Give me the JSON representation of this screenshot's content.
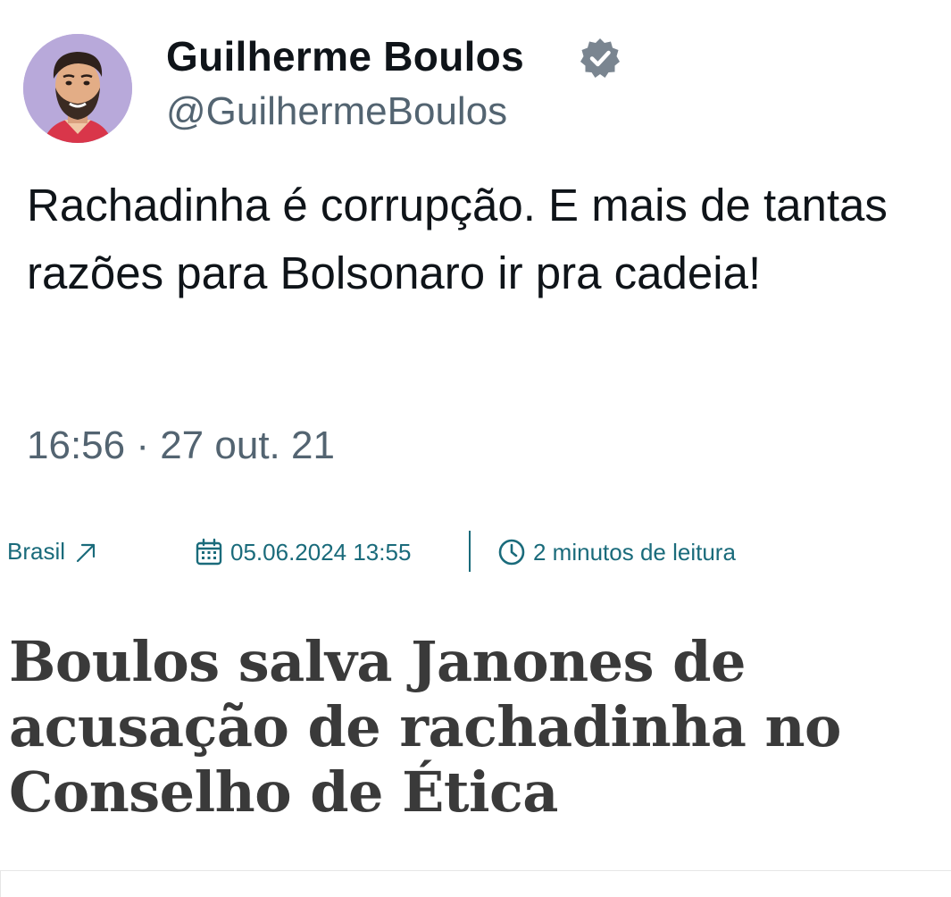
{
  "tweet": {
    "author_name": "Guilherme Boulos",
    "author_handle": "@GuilhermeBoulos",
    "verified_icon": "verified-badge-icon",
    "avatar_icon": "avatar-illustration",
    "text": "Rachadinha é corrupção. E mais de tantas razões para Bolsonaro ir pra cadeia!",
    "timestamp": "16:56 · 27 out. 21"
  },
  "article": {
    "category": "Brasil",
    "category_icon": "arrow-up-right-icon",
    "date_icon": "calendar-icon",
    "date": "05.06.2024 13:55",
    "reading_icon": "clock-icon",
    "reading_time": "2 minutos de leitura",
    "headline": "Boulos salva Janones de acusação de rachadinha no Conselho de Ética"
  },
  "colors": {
    "text_primary": "#0f1419",
    "text_secondary": "#536471",
    "meta_accent": "#1a6b7b",
    "headline": "#3a3a3a",
    "avatar_bg": "#b8a9da"
  }
}
